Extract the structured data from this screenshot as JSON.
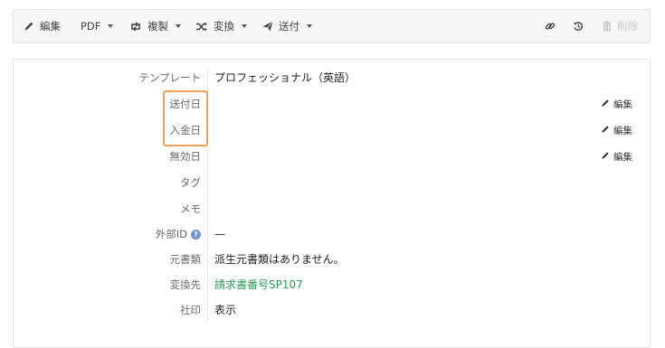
{
  "toolbar": {
    "edit_label": "編集",
    "pdf_label": "PDF",
    "duplicate_label": "複製",
    "convert_label": "変換",
    "send_label": "送付",
    "delete_label": "削除"
  },
  "details": {
    "template": {
      "label": "テンプレート",
      "value": "プロフェッショナル（英語）"
    },
    "sent_date": {
      "label": "送付日",
      "edit_label": "編集"
    },
    "payment_date": {
      "label": "入金日",
      "edit_label": "編集"
    },
    "void_date": {
      "label": "無効日",
      "edit_label": "編集"
    },
    "tags": {
      "label": "タグ"
    },
    "memo": {
      "label": "メモ"
    },
    "external_id": {
      "label": "外部ID",
      "value": "—",
      "help_glyph": "?"
    },
    "source_doc": {
      "label": "元書類",
      "value": "派生元書類はありません。"
    },
    "converted_to": {
      "label": "変換先",
      "value": "請求書番号SP107"
    },
    "company_seal": {
      "label": "社印",
      "value": "表示"
    }
  },
  "colors": {
    "link": "#2c9c58",
    "highlight": "#f0a05a",
    "help": "#6c93d6"
  }
}
